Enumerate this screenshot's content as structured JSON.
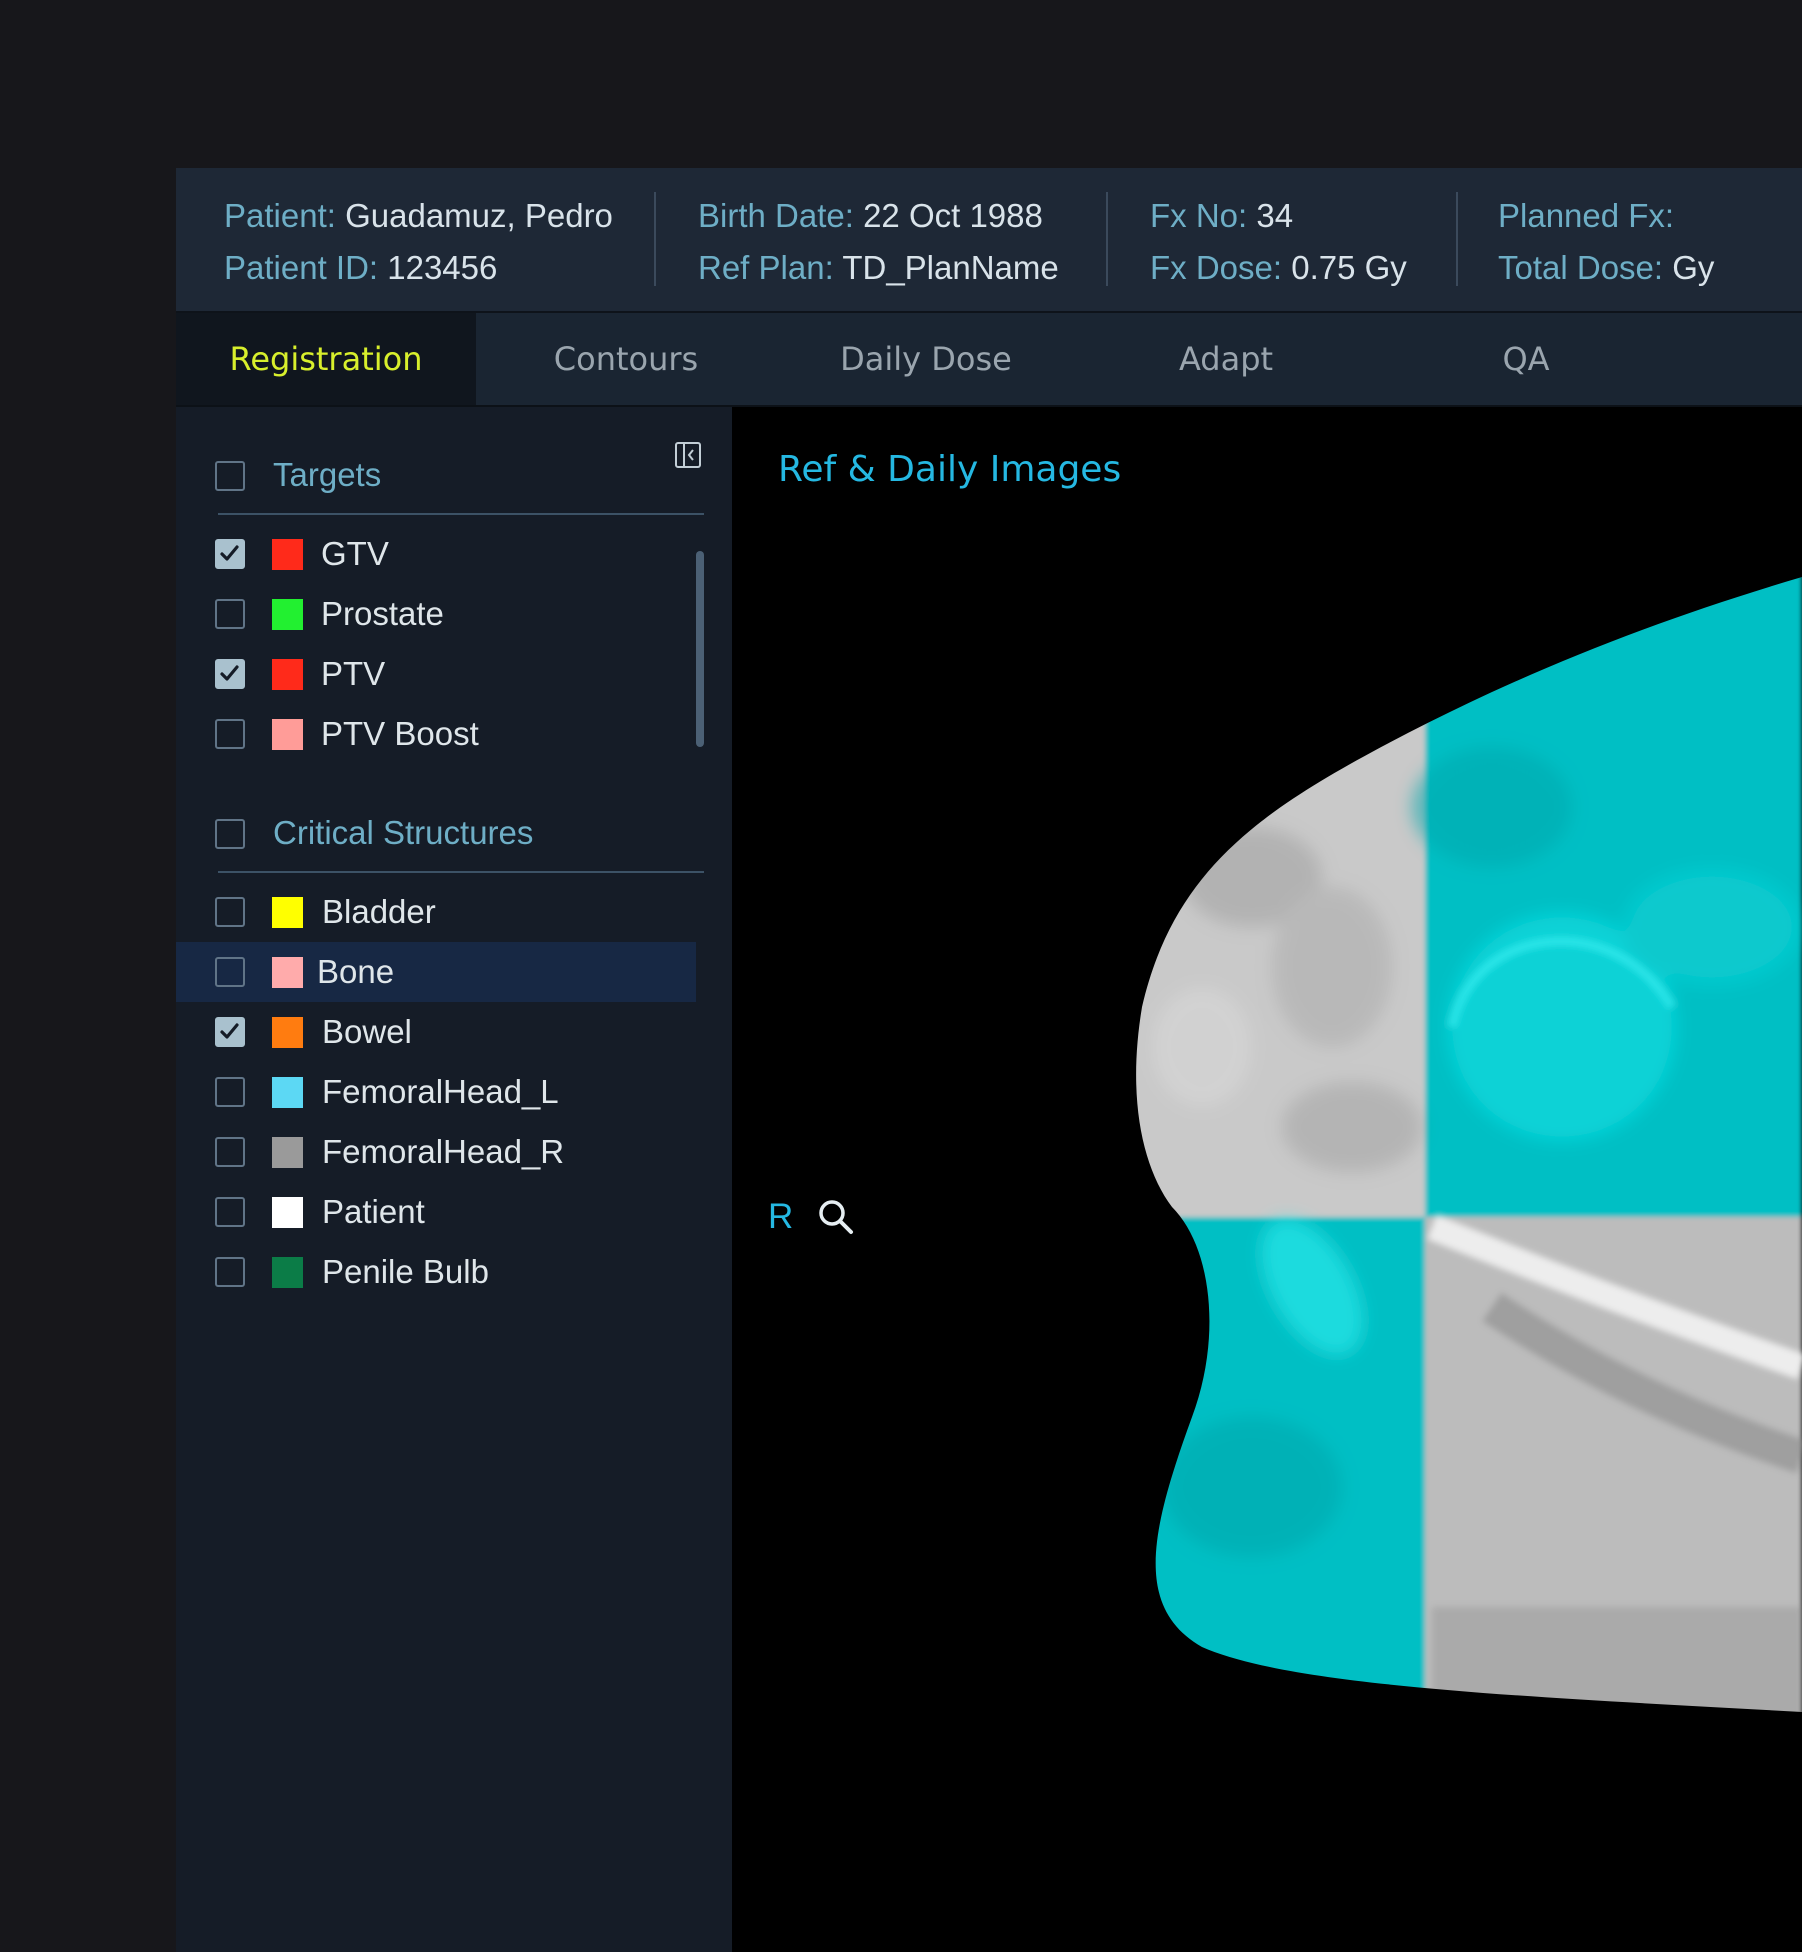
{
  "header": {
    "patient_label": "Patient:",
    "patient_value": "Guadamuz, Pedro",
    "patient_id_label": "Patient ID:",
    "patient_id_value": "123456",
    "birth_date_label": "Birth Date:",
    "birth_date_value": "22 Oct 1988",
    "ref_plan_label": "Ref Plan:",
    "ref_plan_value": "TD_PlanName",
    "fx_no_label": "Fx No:",
    "fx_no_value": "34",
    "fx_dose_label": "Fx Dose:",
    "fx_dose_value": "0.75 Gy",
    "planned_fx_label": "Planned Fx:",
    "planned_fx_value": "",
    "total_dose_label": "Total Dose:",
    "total_dose_value": "Gy"
  },
  "tabs": [
    {
      "label": "Registration",
      "active": true
    },
    {
      "label": "Contours",
      "active": false
    },
    {
      "label": "Daily Dose",
      "active": false
    },
    {
      "label": "Adapt",
      "active": false
    },
    {
      "label": "QA",
      "active": false
    }
  ],
  "panel": {
    "collapse_icon": "panel-collapse-icon",
    "groups": [
      {
        "title": "Targets",
        "checked": false,
        "items": [
          {
            "label": "GTV",
            "color": "#ff2a1a",
            "checked": true
          },
          {
            "label": "Prostate",
            "color": "#22f030",
            "checked": false
          },
          {
            "label": "PTV",
            "color": "#ff2a1a",
            "checked": true
          },
          {
            "label": "PTV Boost",
            "color": "#ff9c98",
            "checked": false
          }
        ]
      },
      {
        "title": "Critical Structures",
        "checked": false,
        "items": [
          {
            "label": "Bladder",
            "color": "#ffff00",
            "checked": false
          },
          {
            "label": "Bone",
            "color": "#ffabab",
            "checked": false,
            "hover": true
          },
          {
            "label": "Bowel",
            "color": "#ff7c10",
            "checked": true
          },
          {
            "label": "FemoralHead_L",
            "color": "#5cd8f4",
            "checked": false
          },
          {
            "label": "FemoralHead_R",
            "color": "#9a9a9a",
            "checked": false
          },
          {
            "label": "Patient",
            "color": "#ffffff",
            "checked": false
          },
          {
            "label": "Penile Bulb",
            "color": "#0b7c47",
            "checked": false
          }
        ]
      }
    ]
  },
  "viewer": {
    "title": "Ref & Daily Images",
    "orientation_label": "R",
    "zoom_icon": "magnifier-icon",
    "overlay_color": "#00bfc4"
  }
}
